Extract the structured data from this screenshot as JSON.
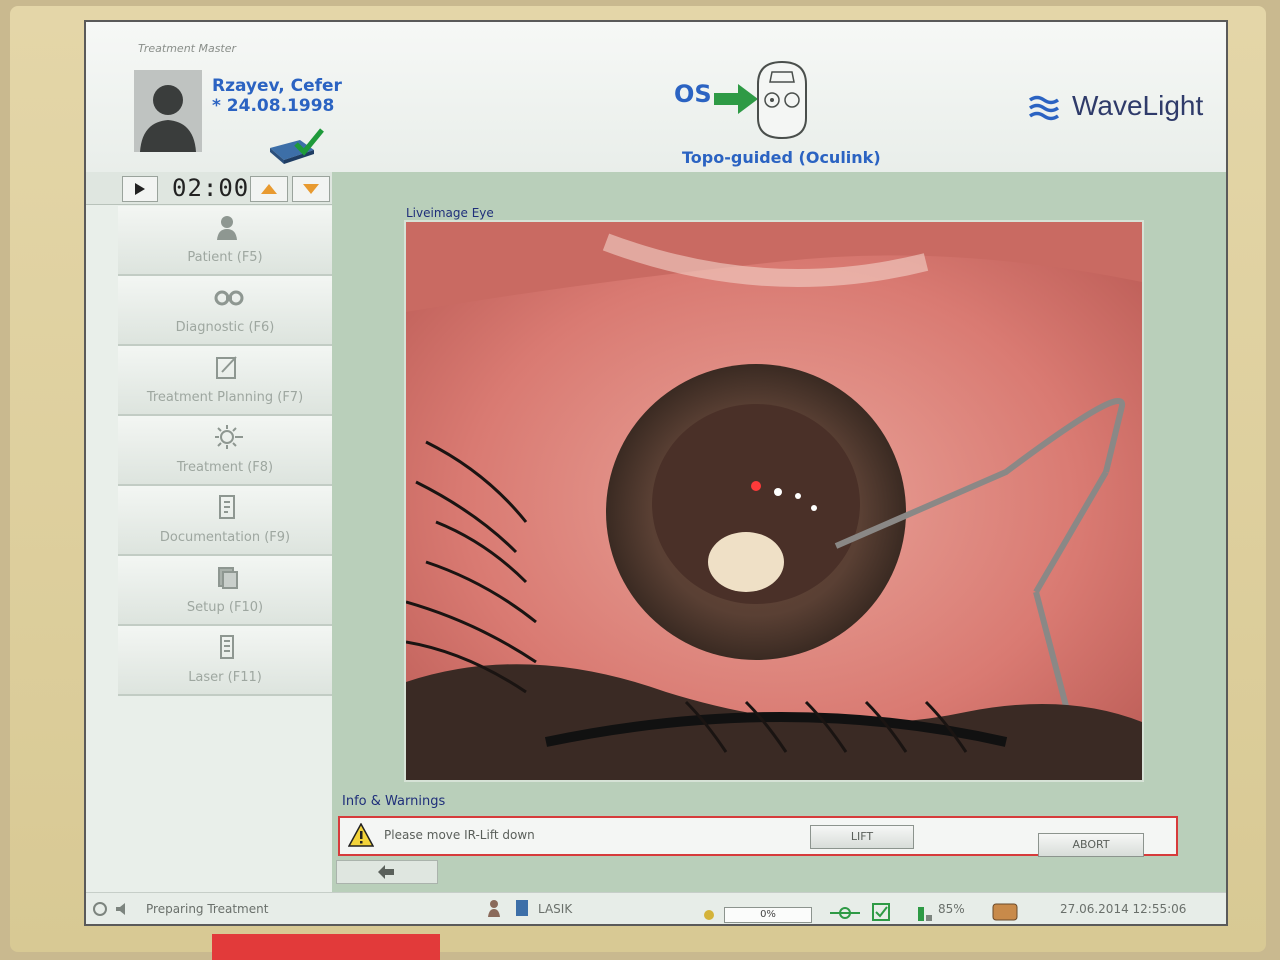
{
  "window": {
    "title": "Treatment Master"
  },
  "patient": {
    "name": "Rzayev, Cefer",
    "dob": "* 24.08.1998"
  },
  "eye": {
    "side": "OS",
    "mode": "Topo-guided (Oculink)"
  },
  "brand": {
    "name": "WaveLight"
  },
  "timer": {
    "value": "02:00"
  },
  "nav": {
    "items": [
      {
        "label": "Patient (F5)",
        "icon": "person-icon"
      },
      {
        "label": "Diagnostic (F6)",
        "icon": "diagnostic-icon"
      },
      {
        "label": "Treatment Planning (F7)",
        "icon": "planning-icon"
      },
      {
        "label": "Treatment (F8)",
        "icon": "treatment-icon"
      },
      {
        "label": "Documentation (F9)",
        "icon": "documentation-icon"
      },
      {
        "label": "Setup (F10)",
        "icon": "setup-icon"
      },
      {
        "label": "Laser (F11)",
        "icon": "laser-icon"
      }
    ]
  },
  "live": {
    "title": "Liveimage Eye"
  },
  "info": {
    "title": "Info & Warnings",
    "message": "Please move IR-Lift down",
    "lift_label": "LIFT",
    "abort_label": "ABORT"
  },
  "status": {
    "left_text": "Preparing Treatment",
    "procedure": "LASIK",
    "progress": "0%",
    "battery": "85%",
    "datetime": "27.06.2014 12:55:06"
  },
  "colors": {
    "accent": "#2b63c2",
    "warning_border": "#d63b3b",
    "panel": "#b9cfba"
  }
}
